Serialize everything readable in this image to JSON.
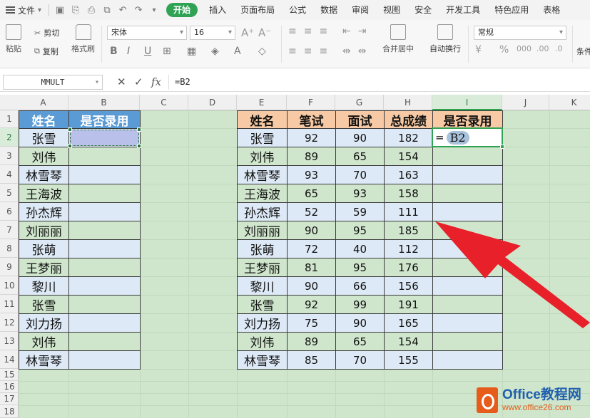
{
  "menu": {
    "file_label": "文件",
    "tabs": [
      "开始",
      "插入",
      "页面布局",
      "公式",
      "数据",
      "审阅",
      "视图",
      "安全",
      "开发工具",
      "特色应用",
      "表格"
    ],
    "active_tab": "开始"
  },
  "ribbon": {
    "paste": "粘贴",
    "cut": "剪切",
    "copy": "复制",
    "format_painter": "格式刷",
    "font_name": "宋体",
    "font_size": "16",
    "merge_center": "合并居中",
    "wrap_text": "自动换行",
    "number_format": "常规",
    "condition": "条件"
  },
  "formula_bar": {
    "name_box": "MMULT",
    "cancel_icon": "✕",
    "confirm_icon": "✓",
    "fx_label": "fx",
    "content": "=B2"
  },
  "sheet": {
    "columns": [
      "A",
      "B",
      "C",
      "D",
      "E",
      "F",
      "G",
      "H",
      "I",
      "J",
      "K"
    ],
    "rows": [
      "1",
      "2",
      "3",
      "4",
      "5",
      "6",
      "7",
      "8",
      "9",
      "10",
      "11",
      "12",
      "13",
      "14",
      "15",
      "16",
      "17",
      "18"
    ],
    "selected_column": "I",
    "selected_row": "2",
    "left_table": {
      "headers": [
        "姓名",
        "是否录用"
      ],
      "names": [
        "张雪",
        "刘伟",
        "林雪琴",
        "王海波",
        "孙杰辉",
        "刘丽丽",
        "张萌",
        "王梦丽",
        "黎川",
        "张雪",
        "刘力扬",
        "刘伟",
        "林雪琴"
      ]
    },
    "right_table": {
      "headers": [
        "姓名",
        "笔试",
        "面试",
        "总成绩",
        "是否录用"
      ],
      "rows": [
        [
          "张雪",
          "92",
          "90",
          "182"
        ],
        [
          "刘伟",
          "89",
          "65",
          "154"
        ],
        [
          "林雪琴",
          "93",
          "70",
          "163"
        ],
        [
          "王海波",
          "65",
          "93",
          "158"
        ],
        [
          "孙杰辉",
          "52",
          "59",
          "111"
        ],
        [
          "刘丽丽",
          "90",
          "95",
          "185"
        ],
        [
          "张萌",
          "72",
          "40",
          "112"
        ],
        [
          "王梦丽",
          "81",
          "95",
          "176"
        ],
        [
          "黎川",
          "90",
          "66",
          "156"
        ],
        [
          "张雪",
          "92",
          "99",
          "191"
        ],
        [
          "刘力扬",
          "75",
          "90",
          "165"
        ],
        [
          "刘伟",
          "89",
          "65",
          "154"
        ],
        [
          "林雪琴",
          "85",
          "70",
          "155"
        ]
      ]
    },
    "active_cell": {
      "eq": "=",
      "ref": "B2"
    }
  },
  "watermark": {
    "brand": "Office教程网",
    "url": "www.office26.com"
  },
  "colors": {
    "accent_green": "#2fa254",
    "left_header_blue": "#5b9bd5",
    "right_header_peach": "#f7c9a4",
    "arrow_red": "#e8202a",
    "sheet_bg": "#cfe6cc"
  }
}
